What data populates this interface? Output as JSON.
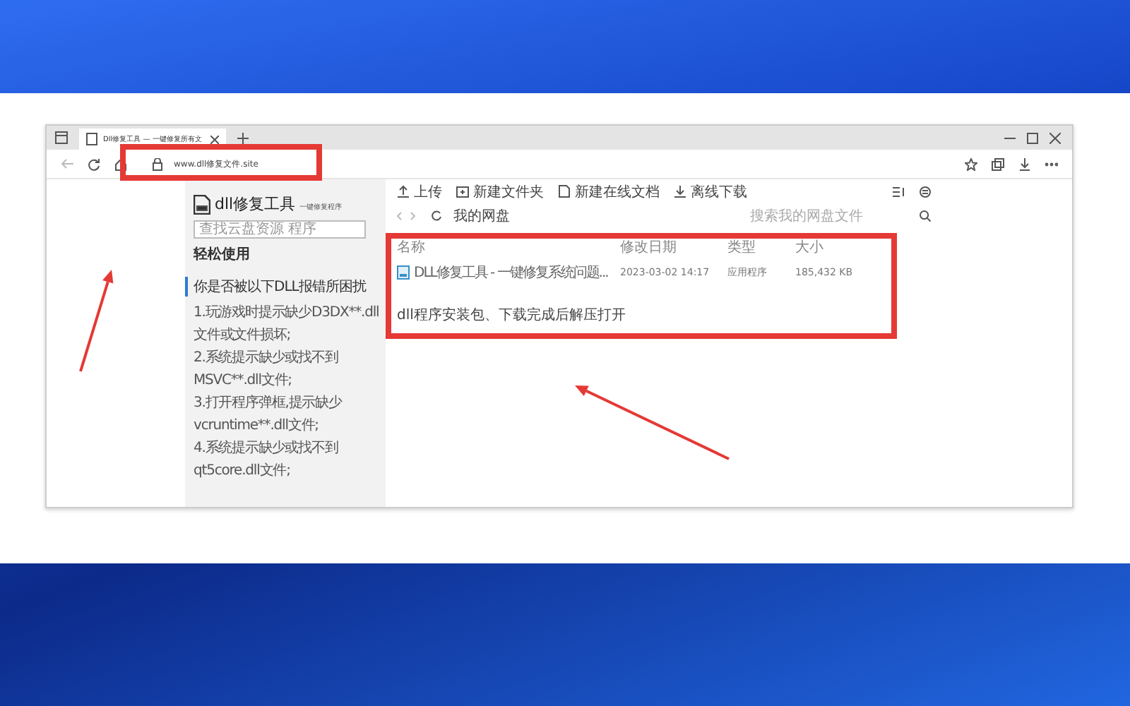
{
  "browser": {
    "tab_title": "Dll修复工具 — 一键修复所有文",
    "url": "www.dll修复文件.site"
  },
  "sidebar": {
    "logo_title": "dll修复工具",
    "logo_subtitle": "一键修复程序",
    "search_placeholder": "查找云盘资源 程序",
    "section": "轻松使用",
    "heading": "你是否被以下DLL报错所困扰",
    "lines": [
      "1.玩游戏时提示缺少D3DX**.dll",
      "文件或文件损坏;",
      "2.系统提示缺少或找不到",
      "MSVC**.dll文件;",
      "3.打开程序弹框,提示缺少",
      "vcruntime**.dll文件;",
      "4.系统提示缺少或找不到",
      "qt5core.dll文件;"
    ]
  },
  "drive": {
    "toolbar": [
      {
        "label": "上传",
        "kind": "upload"
      },
      {
        "label": "新建文件夹",
        "kind": "folder"
      },
      {
        "label": "新建在线文档",
        "kind": "doc"
      },
      {
        "label": "离线下载",
        "kind": "download"
      }
    ],
    "breadcrumb": "我的网盘",
    "search_placeholder": "搜索我的网盘文件",
    "columns": [
      "名称",
      "修改日期",
      "类型",
      "大小"
    ],
    "rows": [
      {
        "name": "DLL修复工具 - 一键修复系统问题...",
        "date": "2023-03-02 14:17",
        "type": "应用程序",
        "size": "185,432 KB"
      }
    ],
    "note": "dll程序安装包、下载完成后解压打开"
  }
}
